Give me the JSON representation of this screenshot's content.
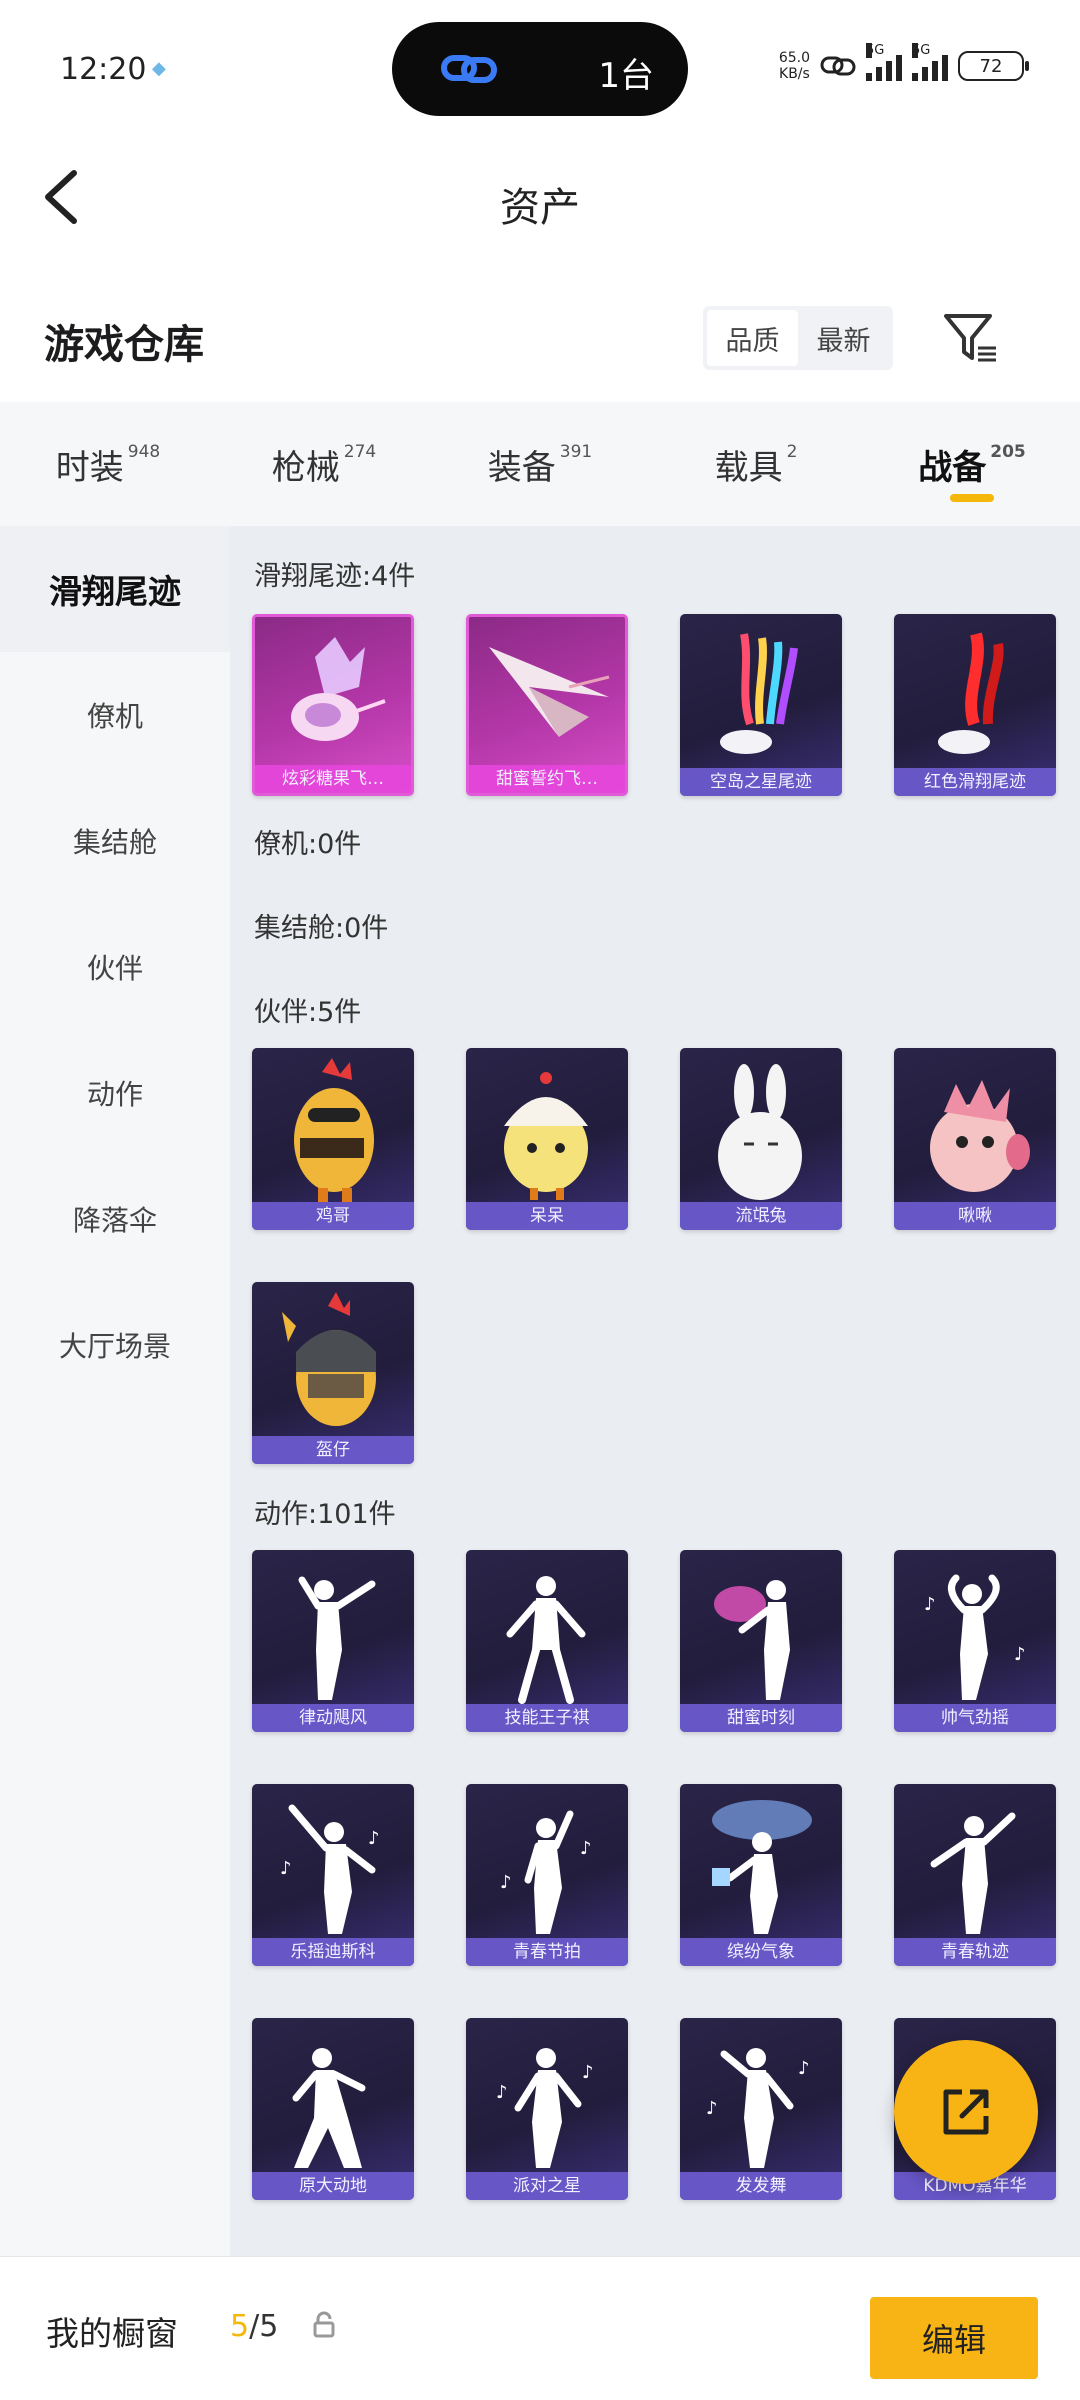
{
  "status_bar": {
    "time": "12:20",
    "device_count": "1台",
    "net_speed": "65.0",
    "net_unit": "KB/s",
    "net1": "5G",
    "net2": "5G",
    "battery": "72"
  },
  "header": {
    "title": "资产"
  },
  "warehouse": {
    "title": "游戏仓库",
    "sort_quality": "品质",
    "sort_newest": "最新"
  },
  "tabs": [
    {
      "label": "时装",
      "count": "948"
    },
    {
      "label": "枪械",
      "count": "274"
    },
    {
      "label": "装备",
      "count": "391"
    },
    {
      "label": "载具",
      "count": "2"
    },
    {
      "label": "战备",
      "count": "205"
    }
  ],
  "sidebar": [
    {
      "label": "滑翔尾迹"
    },
    {
      "label": "僚机"
    },
    {
      "label": "集结舱"
    },
    {
      "label": "伙伴"
    },
    {
      "label": "动作"
    },
    {
      "label": "降落伞"
    },
    {
      "label": "大厅场景"
    }
  ],
  "sections": {
    "glide": {
      "title": "滑翔尾迹:4件",
      "items": [
        "炫彩糖果飞…",
        "甜蜜誓约飞…",
        "空岛之星尾迹",
        "红色滑翔尾迹"
      ]
    },
    "wingman": {
      "title": "僚机:0件"
    },
    "capsule": {
      "title": "集结舱:0件"
    },
    "partner": {
      "title": "伙伴:5件",
      "items": [
        "鸡哥",
        "呆呆",
        "流氓兔",
        "啾啾",
        "盔仔"
      ]
    },
    "action": {
      "title": "动作:101件",
      "items": [
        "律动飓风",
        "技能王子祺",
        "甜蜜时刻",
        "帅气劲摇",
        "乐摇迪斯科",
        "青春节拍",
        "缤纷气象",
        "青春轨迹",
        "原大动地",
        "派对之星",
        "发发舞",
        "KDMO嘉年华"
      ]
    }
  },
  "bottom_bar": {
    "label": "我的橱窗",
    "current": "5",
    "total": "/5",
    "edit": "编辑"
  },
  "colors": {
    "accent": "#f5b80a",
    "card_purple": "#2a2448",
    "card_pink": "#b437a8"
  }
}
